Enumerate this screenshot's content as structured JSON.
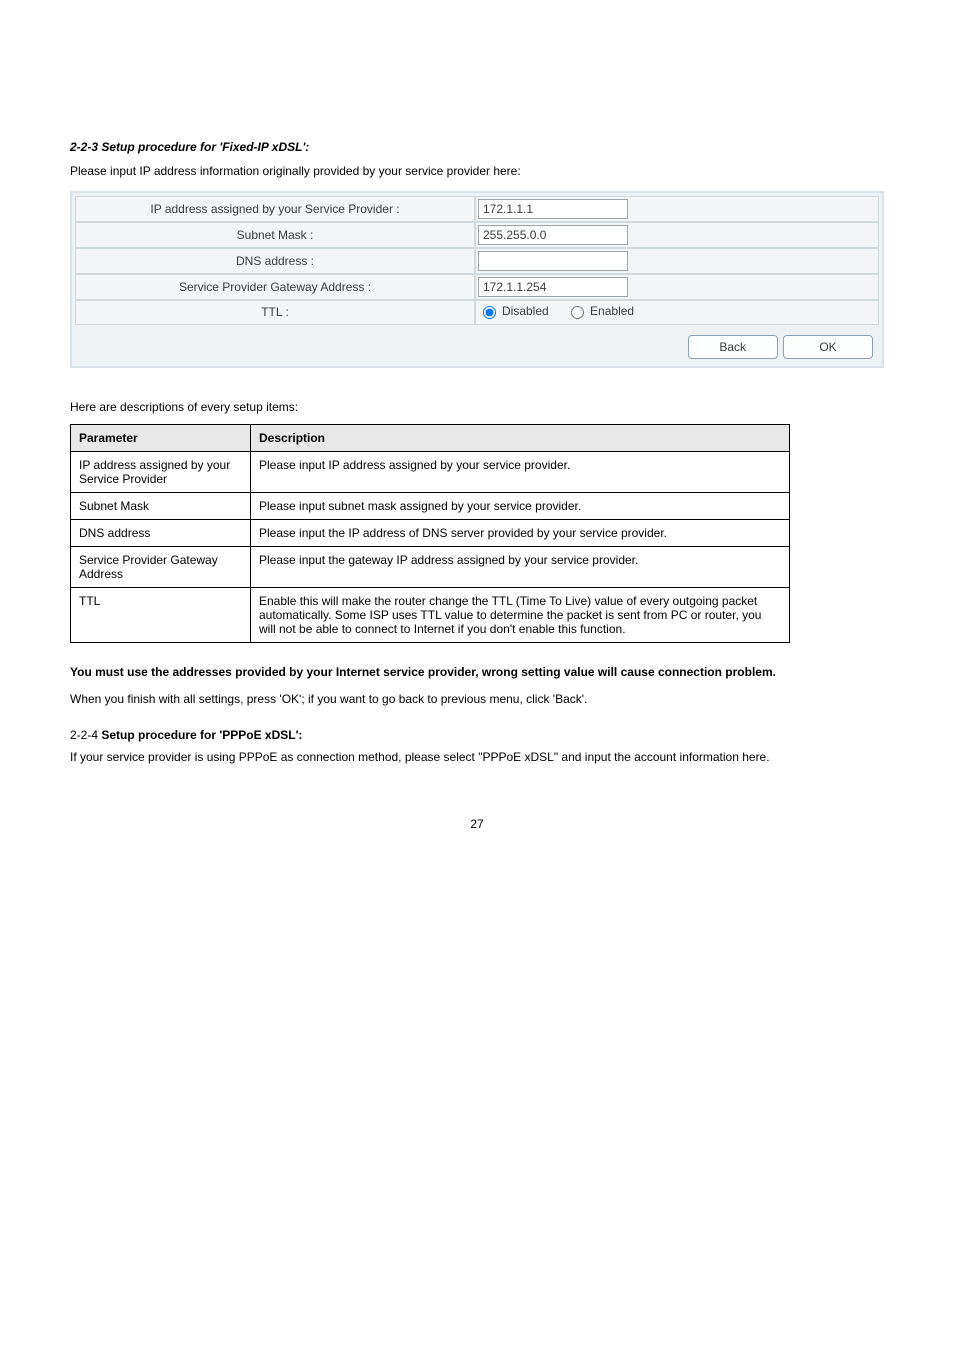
{
  "section": {
    "heading": "2-2-3 Setup procedure for 'Fixed-IP xDSL':",
    "intro": "Please input IP address information originally provided by your service provider here:"
  },
  "form": {
    "rows": [
      {
        "label": "IP address assigned by your Service Provider :",
        "value": "172.1.1.1",
        "name": "ip-address-input"
      },
      {
        "label": "Subnet Mask :",
        "value": "255.255.0.0",
        "name": "subnet-mask-input"
      },
      {
        "label": "DNS address :",
        "value": "",
        "name": "dns-address-input"
      },
      {
        "label": "Service Provider Gateway Address :",
        "value": "172.1.1.254",
        "name": "gateway-address-input"
      }
    ],
    "ttl": {
      "label": "TTL :",
      "options": {
        "disabled": "Disabled",
        "enabled": "Enabled"
      },
      "selected": "disabled"
    },
    "buttons": {
      "back": "Back",
      "ok": "OK"
    }
  },
  "desc_intro": "Here are descriptions of every setup items:",
  "desc_table": {
    "headers": {
      "param": "Parameter",
      "desc": "Description"
    },
    "rows": [
      {
        "param": "IP address assigned by your Service Provider",
        "desc": "Please input IP address assigned by your service provider."
      },
      {
        "param": "Subnet Mask",
        "desc": "Please input subnet mask assigned by your service provider."
      },
      {
        "param": "DNS address",
        "desc": "Please input the IP address of DNS server provided by your service provider."
      },
      {
        "param": "Service Provider Gateway Address",
        "desc": "Please input the gateway IP address assigned by your service provider."
      },
      {
        "param": "TTL",
        "desc": "Enable this will make the router change the TTL (Time To Live) value of every outgoing packet automatically. Some ISP uses TTL value to determine the packet is sent from PC or router, you will not be able to connect to Internet if you don't enable this function."
      }
    ]
  },
  "note": {
    "prefix": "You must use the addresses provided by your Internet service provider, wrong setting value will cause connection problem.",
    "rest": ""
  },
  "post_note": "When you finish with all settings, press 'OK'; if you want to go back to previous menu, click 'Back'.",
  "pppoe": {
    "title_num": "2-2-4 ",
    "title_lead": "Setup procedure for 'PPPoE xDSL':",
    "para": "If your service provider is using PPPoE as connection method, please select \"PPPoE xDSL\" and input the account information here."
  },
  "footer": "27"
}
